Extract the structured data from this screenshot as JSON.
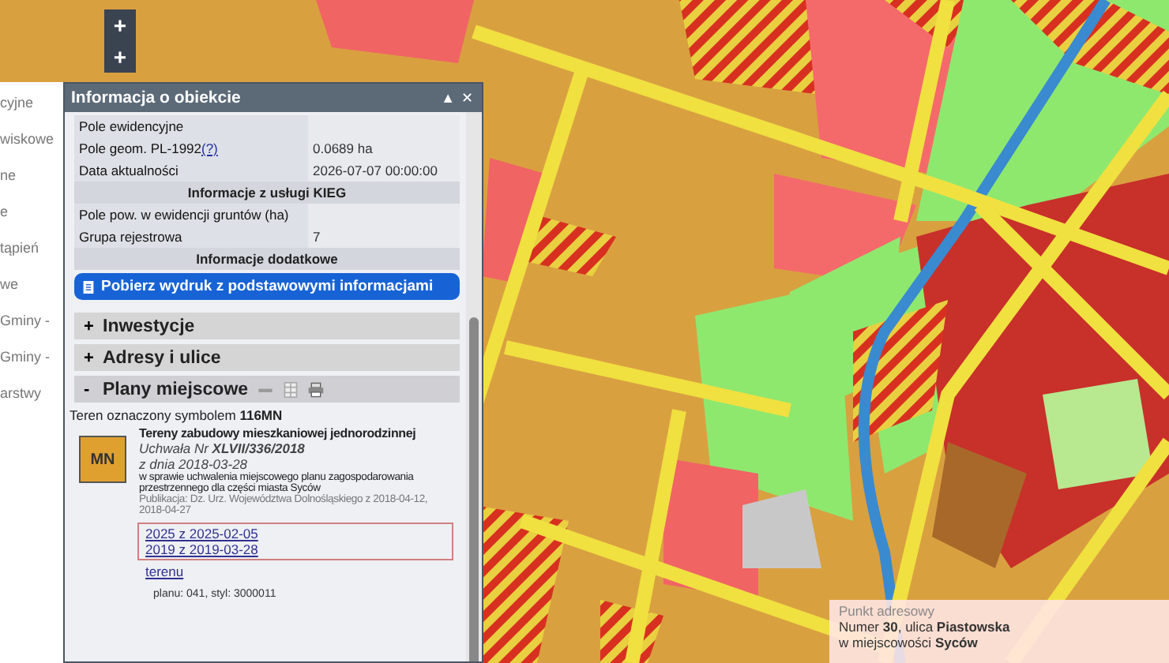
{
  "map_controls": [
    "+",
    "+"
  ],
  "sidebar": {
    "fragments": [
      "cyjne",
      "wiskowe",
      "ne",
      "e",
      "tąpień",
      "we",
      "Gminy -",
      "Gminy -",
      "arstwy"
    ]
  },
  "panel": {
    "title": "Informacja o obiekcie",
    "controls": [
      "▲",
      "✕"
    ],
    "rows": [
      {
        "kind": "row",
        "label": "Pole ewidencyjne"
      },
      {
        "kind": "row",
        "label": "Pole geom. PL-1992",
        "help_link": "(?)",
        "value": "0.0689 ha"
      },
      {
        "kind": "row",
        "label": "Data aktualności",
        "value": "2026-07-07 00:00:00"
      },
      {
        "kind": "header",
        "label": "Informacje z usługi KIEG"
      },
      {
        "kind": "row",
        "label": "Pole pow. w ewidencji gruntów (ha)"
      },
      {
        "kind": "row",
        "label": "Grupa rejestrowa",
        "value": "7"
      },
      {
        "kind": "header",
        "label": "Informacje dodatkowe"
      }
    ],
    "print_button": "Pobierz wydruk z podstawowymi informacjami",
    "sections": [
      {
        "sign": "+",
        "title": "Inwestycje",
        "expanded": false
      },
      {
        "sign": "+",
        "title": "Adresy i ulice",
        "expanded": false
      },
      {
        "sign": "-",
        "title": "Plany miejscowe",
        "expanded": true
      }
    ],
    "plan": {
      "intro": "Teren oznaczony symbolem **116MN**",
      "symbol": "MN",
      "title": "Tereny zabudowy mieszkaniowej jednorodzinnej",
      "resolution": "Uchwała Nr **XLVII/336/2018**",
      "date": "z dnia 2018-03-28",
      "description": "w sprawie uchwalenia miejscowego planu zagospodarowania przestrzennego dla części miasta Syców",
      "publication": "Publikacja: Dz. Urz. Województwa Dolnośląskiego z 2018-04-12,",
      "effective": "2018-04-27",
      "amendments": [
        "2025 z 2025-02-05",
        "2019 z 2019-03-28"
      ],
      "link": "terenu",
      "footer": "planu: 041, styl: 3000011"
    }
  },
  "address_popup": {
    "heading": "Punkt adresowy",
    "line_1": "Numer **30**, ulica **Piastowska**",
    "line_2": "w miejscowości **Syców**"
  }
}
